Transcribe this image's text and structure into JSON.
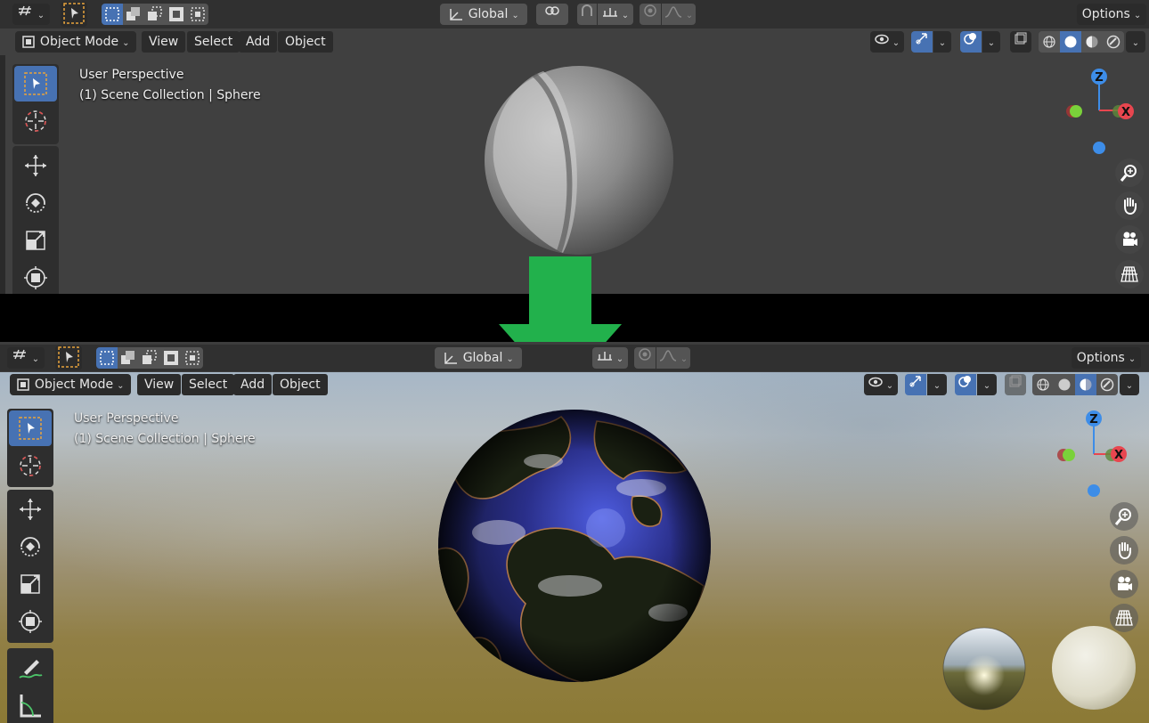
{
  "top_viewport": {
    "header": {
      "transform_orientation": "Global",
      "options_label": "Options"
    },
    "mode_menu": {
      "mode": "Object Mode",
      "menus": [
        "View",
        "Select",
        "Add",
        "Object"
      ]
    },
    "overlay": {
      "line1": "User Perspective",
      "line2": "(1) Scene Collection | Sphere"
    },
    "gizmo": {
      "z": "Z",
      "x": "X"
    }
  },
  "bottom_viewport": {
    "header": {
      "transform_orientation": "Global",
      "options_label": "Options"
    },
    "mode_menu": {
      "mode": "Object Mode",
      "menus": [
        "View",
        "Select",
        "Add",
        "Object"
      ]
    },
    "overlay": {
      "line1": "User Perspective",
      "line2": "(1) Scene Collection | Sphere"
    },
    "gizmo": {
      "z": "Z",
      "x": "X"
    }
  },
  "colors": {
    "arrow": "#22b14c",
    "header_bg": "#303030",
    "viewport_bg": "#404040",
    "active_blue": "#4772b3",
    "axis_x": "#e8464f",
    "axis_y": "#7ad13a",
    "axis_z": "#3d8de8"
  },
  "icons": {
    "toolbar_top": [
      "select-box-icon",
      "cursor-icon",
      "move-icon",
      "rotate-icon",
      "scale-icon",
      "transform-icon"
    ],
    "toolbar_bottom": [
      "select-box-icon",
      "cursor-icon",
      "move-icon",
      "rotate-icon",
      "scale-icon",
      "transform-icon",
      "annotate-icon",
      "measure-icon"
    ],
    "nav": [
      "zoom-icon",
      "hand-pan-icon",
      "camera-icon",
      "grid-perspective-icon"
    ]
  }
}
